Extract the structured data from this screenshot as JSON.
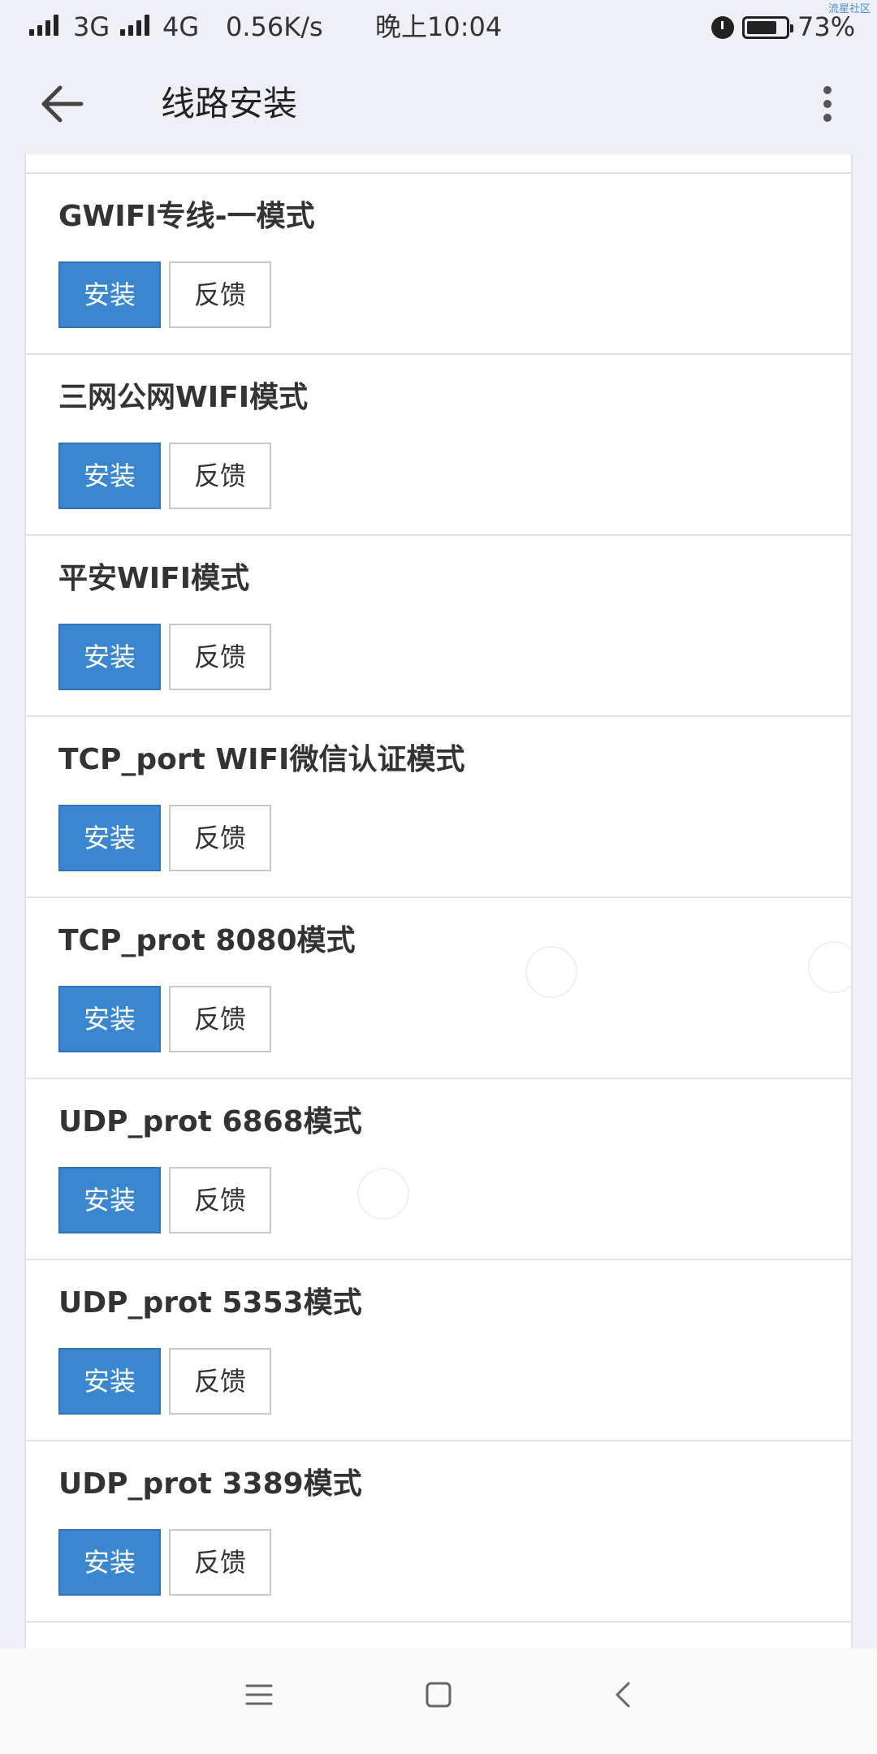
{
  "status_bar": {
    "carrier1": "3G",
    "carrier2": "4G",
    "speed": "0.56K/s",
    "time": "晚上10:04",
    "battery": "73%",
    "watermark": "流星社区"
  },
  "header": {
    "title": "线路安装"
  },
  "items": [
    {
      "title": "GWIFI专线-一模式",
      "install_label": "安装",
      "feedback_label": "反馈"
    },
    {
      "title": "三网公网WIFI模式",
      "install_label": "安装",
      "feedback_label": "反馈"
    },
    {
      "title": "平安WIFI模式",
      "install_label": "安装",
      "feedback_label": "反馈"
    },
    {
      "title": "TCP_port WIFI微信认证模式",
      "install_label": "安装",
      "feedback_label": "反馈"
    },
    {
      "title": "TCP_prot 8080模式",
      "install_label": "安装",
      "feedback_label": "反馈"
    },
    {
      "title": "UDP_prot 6868模式",
      "install_label": "安装",
      "feedback_label": "反馈"
    },
    {
      "title": "UDP_prot 5353模式",
      "install_label": "安装",
      "feedback_label": "反馈"
    },
    {
      "title": "UDP_prot 3389模式",
      "install_label": "安装",
      "feedback_label": "反馈"
    }
  ],
  "colors": {
    "primary": "#3b87cf",
    "background": "#eef0f6"
  },
  "icons": {
    "back": "arrow-left-icon",
    "more": "more-vertical-icon",
    "nav_menu": "menu-icon",
    "nav_home": "home-square-icon",
    "nav_back": "chevron-left-icon"
  }
}
